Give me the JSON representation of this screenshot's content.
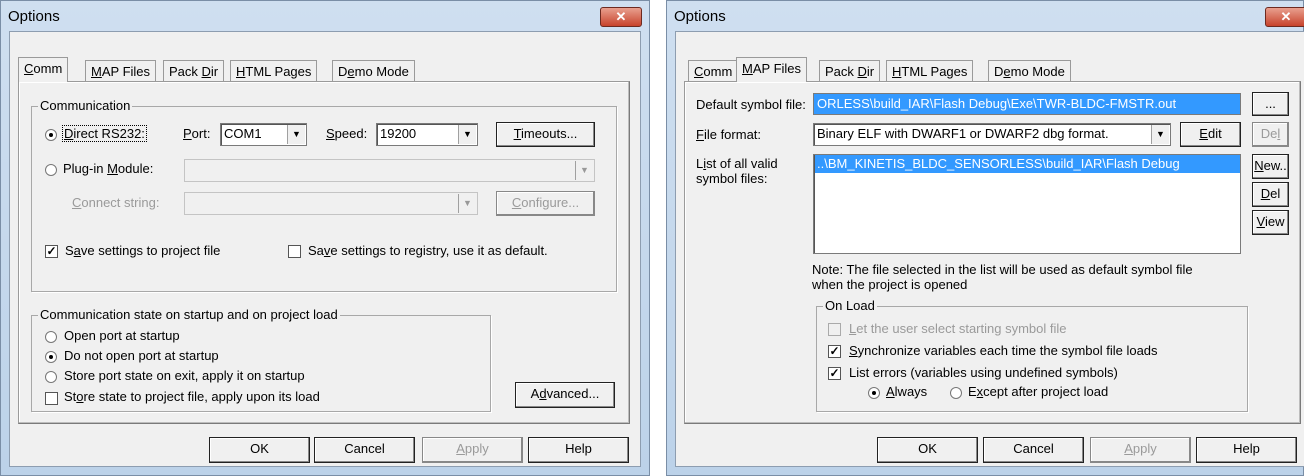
{
  "left": {
    "title": "Options",
    "close": "✕",
    "tabs": [
      {
        "pre": "",
        "u": "C",
        "post": "omm"
      },
      {
        "pre": "",
        "u": "M",
        "post": "AP Files"
      },
      {
        "pre": "Pack ",
        "u": "D",
        "post": "ir"
      },
      {
        "pre": "",
        "u": "H",
        "post": "TML Pages"
      },
      {
        "pre": "D",
        "u": "e",
        "post": "mo Mode"
      }
    ],
    "comm_group": "Communication",
    "direct": {
      "pre": "",
      "u": "D",
      "post": "irect RS232:"
    },
    "port": {
      "pre": "",
      "u": "P",
      "post": "ort:"
    },
    "port_value": "COM1",
    "speed": {
      "pre": "",
      "u": "S",
      "post": "peed:"
    },
    "speed_value": "19200",
    "timeouts": {
      "pre": "",
      "u": "T",
      "post": "imeouts..."
    },
    "plugin": {
      "pre": "Plug-in ",
      "u": "M",
      "post": "odule:"
    },
    "connect": {
      "pre": "",
      "u": "C",
      "post": "onnect string:"
    },
    "configure": {
      "pre": "",
      "u": "C",
      "post": "onfigure..."
    },
    "save_project": {
      "pre": "S",
      "u": "a",
      "post": "ve settings to project file"
    },
    "save_registry": {
      "pre": "Sa",
      "u": "v",
      "post": "e settings to registry, use it as default."
    },
    "state_group": "Communication state on startup and on project load",
    "open_port": "Open port at startup",
    "no_open": "Do not open port at startup",
    "store_exit": "Store port state on exit, apply it on startup",
    "store_project": {
      "pre": "St",
      "u": "o",
      "post": "re state to project file, apply upon its load"
    },
    "advanced": {
      "pre": "A",
      "u": "d",
      "post": "vanced..."
    },
    "ok": "OK",
    "cancel": "Cancel",
    "apply": {
      "pre": "",
      "u": "A",
      "post": "pply"
    },
    "help": "Help"
  },
  "right": {
    "title": "Options",
    "close": "✕",
    "tabs": [
      {
        "pre": "",
        "u": "C",
        "post": "omm"
      },
      {
        "pre": "",
        "u": "M",
        "post": "AP Files"
      },
      {
        "pre": "Pack ",
        "u": "D",
        "post": "ir"
      },
      {
        "pre": "",
        "u": "H",
        "post": "TML Pages"
      },
      {
        "pre": "D",
        "u": "e",
        "post": "mo Mode"
      }
    ],
    "default_symbol_label": "Default symbol file:",
    "default_symbol_value": "ORLESS\\build_IAR\\Flash Debug\\Exe\\TWR-BLDC-FMSTR.out",
    "browse": "...",
    "file_format": {
      "pre": "",
      "u": "F",
      "post": "ile format:"
    },
    "file_format_value": "Binary ELF with DWARF1 or DWARF2 dbg format.",
    "edit": {
      "pre": "",
      "u": "E",
      "post": "dit"
    },
    "del_small": {
      "pre": "De",
      "u": "l",
      "post": ""
    },
    "list_label_1": {
      "pre": "L",
      "u": "i",
      "post": "st of all valid"
    },
    "list_label_2": "symbol files:",
    "list_item": "..\\BM_KINETIS_BLDC_SENSORLESS\\build_IAR\\Flash Debug",
    "new": {
      "pre": "",
      "u": "N",
      "post": "ew.."
    },
    "del": {
      "pre": "",
      "u": "D",
      "post": "el"
    },
    "view": {
      "pre": "",
      "u": "V",
      "post": "iew"
    },
    "note_1": "Note: The file selected in the list will be used as default symbol file",
    "note_2": "when the project is opened",
    "onload_group": "On Load",
    "let_user": {
      "pre": "",
      "u": "L",
      "post": "et the user select starting symbol file"
    },
    "sync": {
      "pre": "",
      "u": "S",
      "post": "ynchronize variables each time the symbol file loads"
    },
    "list_errors": "List errors (variables using undefined symbols)",
    "always": {
      "pre": "",
      "u": "A",
      "post": "lways"
    },
    "except": {
      "pre": "E",
      "u": "x",
      "post": "cept after project load"
    },
    "ok": "OK",
    "cancel": "Cancel",
    "apply": {
      "pre": "",
      "u": "A",
      "post": "pply"
    },
    "help": "Help"
  }
}
